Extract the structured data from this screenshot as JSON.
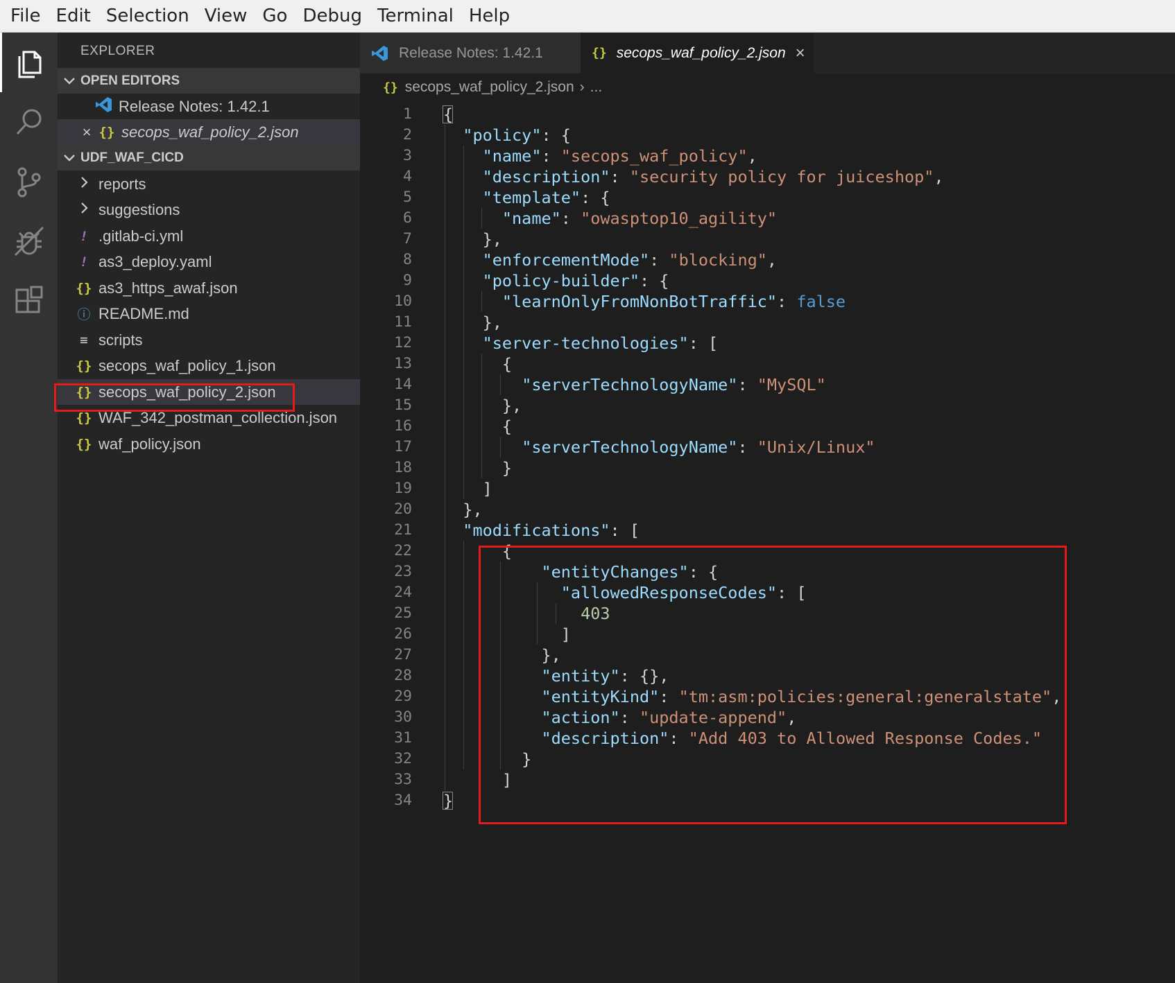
{
  "menu": [
    "File",
    "Edit",
    "Selection",
    "View",
    "Go",
    "Debug",
    "Terminal",
    "Help"
  ],
  "activity_bar": [
    "files-icon",
    "search-icon",
    "source-control-icon",
    "debug-icon",
    "extensions-icon"
  ],
  "sidebar": {
    "title": "EXPLORER",
    "open_editors_label": "OPEN EDITORS",
    "open_editors": [
      {
        "name": "Release Notes: 1.42.1",
        "icon": "vscode-icon"
      },
      {
        "name": "secops_waf_policy_2.json",
        "icon": "json-icon",
        "close": "×"
      }
    ],
    "project_label": "UDF_WAF_CICD",
    "files": [
      {
        "name": "reports",
        "icon": "chevron-right-icon"
      },
      {
        "name": "suggestions",
        "icon": "chevron-right-icon"
      },
      {
        "name": ".gitlab-ci.yml",
        "glyph": "!"
      },
      {
        "name": "as3_deploy.yaml",
        "glyph": "!"
      },
      {
        "name": "as3_https_awaf.json",
        "glyph": "{}"
      },
      {
        "name": "README.md",
        "glyph": "ⓘ"
      },
      {
        "name": "scripts",
        "glyph": "≡"
      },
      {
        "name": "secops_waf_policy_1.json",
        "glyph": "{}"
      },
      {
        "name": "secops_waf_policy_2.json",
        "glyph": "{}"
      },
      {
        "name": "WAF_342_postman_collection.json",
        "glyph": "{}"
      },
      {
        "name": "waf_policy.json",
        "glyph": "{}"
      }
    ]
  },
  "tabs": [
    {
      "label": "Release Notes: 1.42.1",
      "active": false
    },
    {
      "label": "secops_waf_policy_2.json",
      "active": true,
      "close": "×",
      "glyph": "{}"
    }
  ],
  "breadcrumb": {
    "glyph": "{}",
    "file": "secops_waf_policy_2.json",
    "separator": "›",
    "more": "..."
  },
  "editor": {
    "line_numbers": [
      "1",
      "2",
      "3",
      "4",
      "5",
      "6",
      "7",
      "8",
      "9",
      "10",
      "11",
      "12",
      "13",
      "14",
      "15",
      "16",
      "17",
      "18",
      "19",
      "20",
      "21",
      "22",
      "23",
      "24",
      "25",
      "26",
      "27",
      "28",
      "29",
      "30",
      "31",
      "32",
      "33",
      "34"
    ],
    "lines": [
      "{",
      "  \"policy\": {",
      "    \"name\": \"secops_waf_policy\",",
      "    \"description\": \"security policy for juiceshop\",",
      "    \"template\": {",
      "      \"name\": \"owasptop10_agility\"",
      "    },",
      "    \"enforcementMode\": \"blocking\",",
      "    \"policy-builder\": {",
      "      \"learnOnlyFromNonBotTraffic\": false",
      "    },",
      "    \"server-technologies\": [",
      "      {",
      "        \"serverTechnologyName\": \"MySQL\"",
      "      },",
      "      {",
      "        \"serverTechnologyName\": \"Unix/Linux\"",
      "      }",
      "    ]",
      "  },",
      "  \"modifications\": [",
      "      {",
      "          \"entityChanges\": {",
      "            \"allowedResponseCodes\": [",
      "              403",
      "            ]",
      "          },",
      "          \"entity\": {},",
      "          \"entityKind\": \"tm:asm:policies:general:generalstate\",",
      "          \"action\": \"update-append\",",
      "          \"description\": \"Add 403 to Allowed Response Codes.\"",
      "        }",
      "      ]",
      "}"
    ]
  },
  "colors": {
    "key": "#9cdcfe",
    "string": "#ce9178",
    "number": "#b5cea8",
    "boolean": "#569cd6",
    "highlight_box": "#e51a1a",
    "json_icon": "#cbcb41",
    "yaml_icon": "#a074c4",
    "info_icon": "#519aba"
  }
}
